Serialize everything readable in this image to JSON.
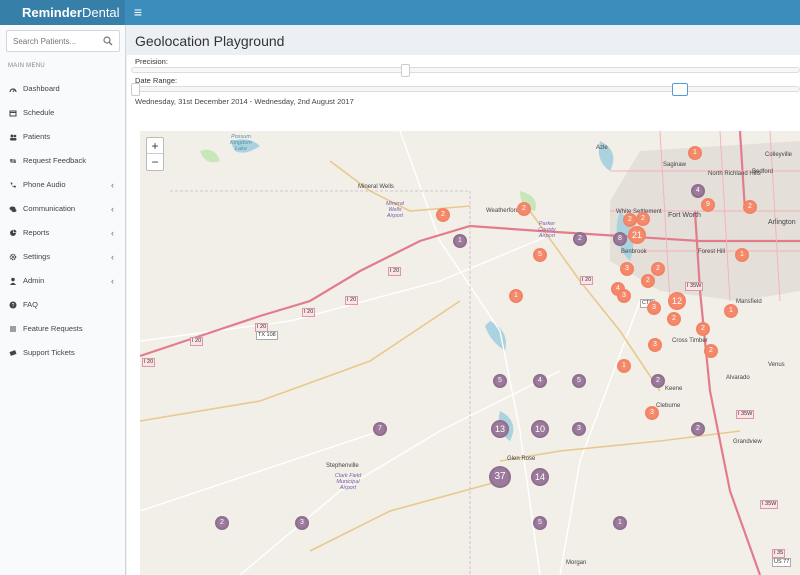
{
  "header": {
    "logo_part1": "Reminder",
    "logo_part2": "Dental",
    "toggle_icon": "≡"
  },
  "sidebar": {
    "search_placeholder": "Search Patients...",
    "menu_header": "MAIN MENU",
    "items": [
      {
        "label": "Dashboard",
        "icon": "dashboard-icon",
        "chevron": ""
      },
      {
        "label": "Schedule",
        "icon": "calendar-icon",
        "chevron": ""
      },
      {
        "label": "Patients",
        "icon": "users-icon",
        "chevron": ""
      },
      {
        "label": "Request Feedback",
        "icon": "retweet-icon",
        "chevron": ""
      },
      {
        "label": "Phone Audio",
        "icon": "phone-icon",
        "chevron": "‹"
      },
      {
        "label": "Communication",
        "icon": "comments-icon",
        "chevron": "‹"
      },
      {
        "label": "Reports",
        "icon": "pie-chart-icon",
        "chevron": "‹"
      },
      {
        "label": "Settings",
        "icon": "gear-icon",
        "chevron": "‹"
      },
      {
        "label": "Admin",
        "icon": "user-icon",
        "chevron": "‹"
      },
      {
        "label": "FAQ",
        "icon": "question-icon",
        "chevron": ""
      },
      {
        "label": "Feature Requests",
        "icon": "list-icon",
        "chevron": ""
      },
      {
        "label": "Support Tickets",
        "icon": "ticket-icon",
        "chevron": ""
      }
    ]
  },
  "main": {
    "title": "Geolocation Playground",
    "precision_label": "Precision:",
    "precision_level": 0.41,
    "date_range_label": "Date Range:",
    "date_range_start": 0.0,
    "date_range_end": 0.82,
    "date_range_text": "Wednesday, 31st December 2014 - Wednesday, 2nd August 2017"
  },
  "map": {
    "zoom_in": "+",
    "zoom_out": "−",
    "places": [
      "Mineral Wells",
      "Weatherford",
      "Fort Worth",
      "Arlington",
      "Saginaw",
      "North Richland Hills",
      "Bedford",
      "Colleyville",
      "White Settlement",
      "Benbrook",
      "Forest Hill",
      "Mansfield",
      "Cross Timber",
      "Cleburne",
      "Alvarado",
      "Venus",
      "Grandview",
      "Glen Rose",
      "Stephenville",
      "Morgan",
      "Azle",
      "Keene"
    ],
    "airports": [
      "Mineral Wells Airport",
      "Parker County Airport",
      "Clark Field Municipal Airport",
      "Possum Kingdom Lake"
    ],
    "road_labels": [
      "I 20",
      "I 20",
      "I 20",
      "I 20",
      "I 20",
      "I 20",
      "TX 108",
      "I 20",
      "I 35W",
      "I 35W",
      "I 35W",
      "I 35",
      "US 77",
      "CTP"
    ],
    "clusters": [
      "1",
      "2",
      "2",
      "2",
      "5",
      "1",
      "2",
      "8",
      "21",
      "2",
      "9",
      "2",
      "3",
      "4",
      "3",
      "1",
      "4",
      "12",
      "3",
      "2",
      "3",
      "2",
      "1",
      "2",
      "5",
      "4",
      "5",
      "2",
      "3",
      "1",
      "7",
      "13",
      "10",
      "3",
      "2",
      "37",
      "14",
      "2",
      "3",
      "5",
      "1",
      "2",
      "2",
      "1"
    ]
  }
}
